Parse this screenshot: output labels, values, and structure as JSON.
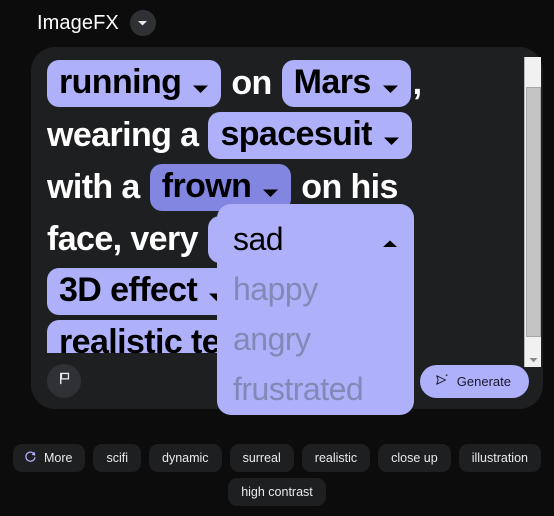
{
  "header": {
    "app_title": "ImageFX",
    "model_chevron_icon": "chevron-down-icon"
  },
  "prompt": {
    "lines": [
      {
        "tokens": [
          {
            "type": "chip",
            "text": "running",
            "state": "normal",
            "icon": "chevron-down-icon"
          },
          {
            "type": "text",
            "text": "on"
          },
          {
            "type": "chip",
            "text": "Mars",
            "state": "normal",
            "icon": "chevron-down-icon"
          },
          {
            "type": "text",
            "text": ","
          }
        ]
      },
      {
        "tokens": [
          {
            "type": "text",
            "text": "wearing a"
          },
          {
            "type": "chip",
            "text": "spacesuit",
            "state": "normal",
            "icon": "chevron-down-icon"
          }
        ]
      },
      {
        "tokens": [
          {
            "type": "text",
            "text": "with a"
          },
          {
            "type": "chip",
            "text": "frown",
            "state": "active",
            "icon": "chevron-down-icon"
          },
          {
            "type": "text",
            "text": "on his"
          }
        ]
      },
      {
        "tokens": [
          {
            "type": "text",
            "text": "face, very"
          },
          {
            "type": "chip",
            "text": "sad",
            "state": "normal",
            "icon": "chevron-down-icon"
          }
        ]
      },
      {
        "tokens": [
          {
            "type": "chip",
            "text": "3D effect",
            "state": "normal",
            "icon": "chevron-down-icon"
          }
        ]
      },
      {
        "tokens": [
          {
            "type": "chip",
            "text": "realistic texture",
            "state": "normal",
            "icon": "chevron-down-icon"
          }
        ]
      }
    ]
  },
  "emotion_dropdown": {
    "selected": "sad",
    "collapse_icon": "chevron-up-icon",
    "options": [
      "happy",
      "angry",
      "frustrated"
    ]
  },
  "footer": {
    "report_icon": "flag-icon",
    "generate_label": "Generate",
    "generate_icon": "send-icon"
  },
  "scrollbar": {
    "down_icon": "triangle-down-icon"
  },
  "suggestions": {
    "rows": [
      [
        {
          "label": "More",
          "icon": "refresh-icon"
        },
        {
          "label": "scifi",
          "icon": null
        },
        {
          "label": "dynamic",
          "icon": null
        },
        {
          "label": "surreal",
          "icon": null
        },
        {
          "label": "realistic",
          "icon": null
        },
        {
          "label": "close up",
          "icon": null
        },
        {
          "label": "illustration",
          "icon": null
        }
      ],
      [
        {
          "label": "high contrast",
          "icon": null
        }
      ]
    ]
  },
  "colors": {
    "page_background": "#0c0c0d",
    "panel_background": "#1e1f21",
    "chip_accent": "#aeb0fa",
    "chip_active": "#8286e0",
    "text_primary": "#ffffff",
    "dropdown_muted_text": "#8488b7"
  }
}
